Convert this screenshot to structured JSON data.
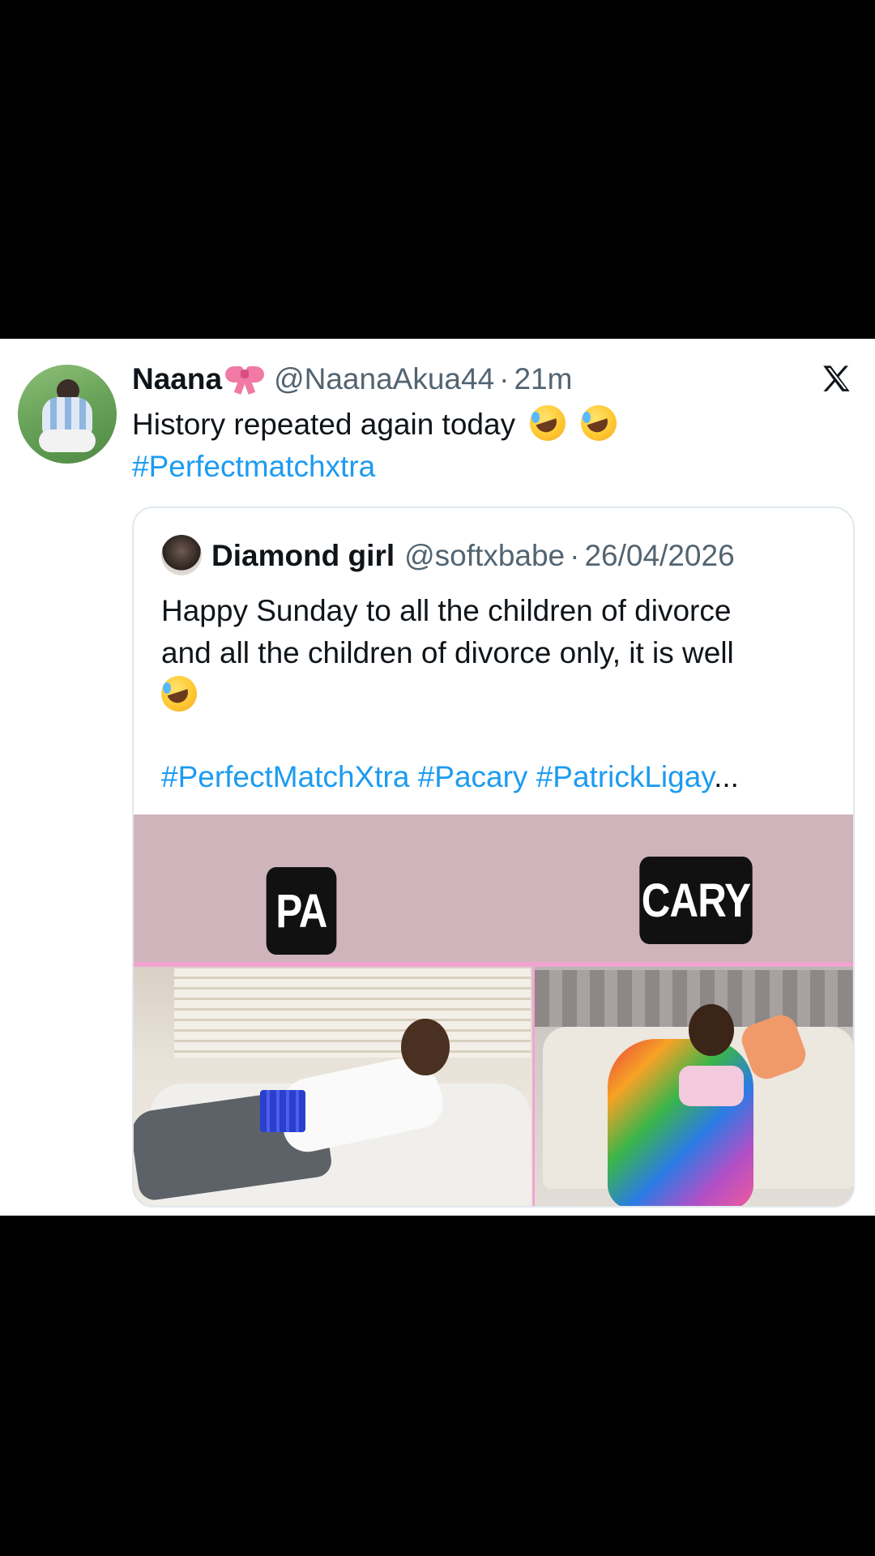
{
  "tweet": {
    "author_name": "Naana",
    "author_name_decoration": "ribbon-bow-emoji",
    "handle": "@NaanaAkua44",
    "separator": "·",
    "time": "21m",
    "text": "History repeated again today",
    "text_emojis": [
      "rolling-on-floor-laughing-emoji",
      "rolling-on-floor-laughing-emoji"
    ],
    "hashtag": "#Perfectmatchxtra"
  },
  "quote": {
    "author_name": "Diamond girl",
    "handle": "@softxbabe",
    "separator": "·",
    "date": "26/04/2026",
    "text_line1": "Happy Sunday to all the children of divorce",
    "text_line2": "and all the children of divorce only, it is well",
    "text_emoji": "rolling-on-floor-laughing-emoji",
    "hashtags": [
      "#PerfectMatchXtra",
      "#Pacary",
      "#PatrickLigay"
    ],
    "ellipsis": "...",
    "media": {
      "label_left": "PA",
      "label_right": "CARY"
    }
  },
  "brand_logo": "x-logo-icon",
  "colors": {
    "background": "#000000",
    "card": "#ffffff",
    "text": "#0f1419",
    "muted": "#536471",
    "link": "#1d9bf0",
    "media_band": "#cfb4bc"
  }
}
